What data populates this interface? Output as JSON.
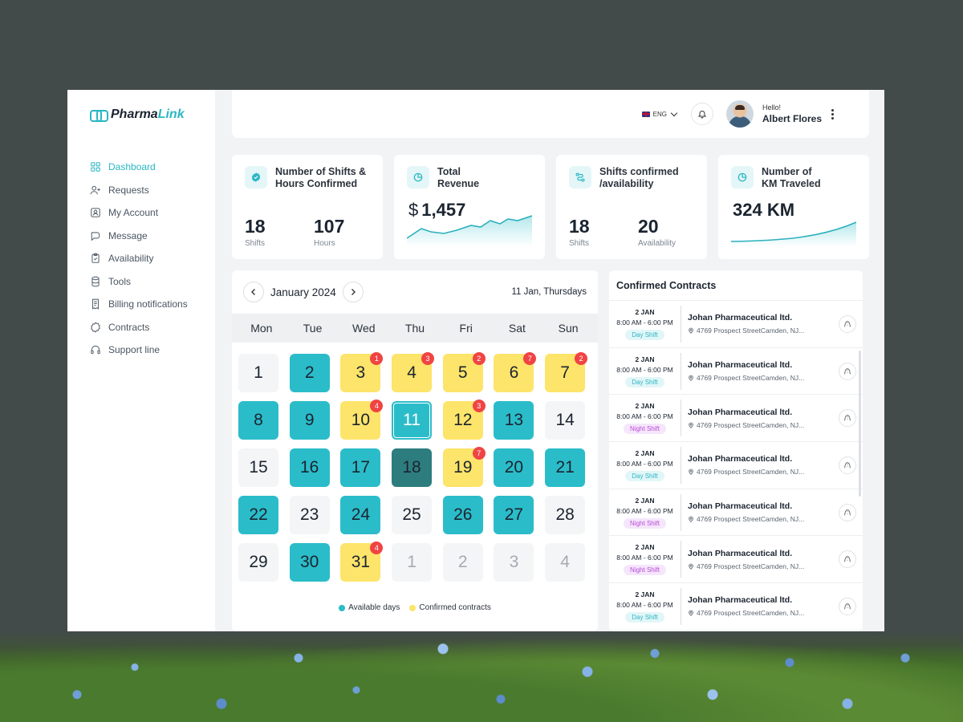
{
  "brand": {
    "name_primary": "Pharma",
    "name_accent": "Link",
    "accent_color": "#2ab7c4"
  },
  "sidebar": {
    "items": [
      {
        "label": "Dashboard",
        "icon": "grid-icon",
        "active": true
      },
      {
        "label": "Requests",
        "icon": "user-plus-icon"
      },
      {
        "label": "My Account",
        "icon": "account-icon"
      },
      {
        "label": "Message",
        "icon": "message-icon"
      },
      {
        "label": "Availability",
        "icon": "clipboard-icon"
      },
      {
        "label": "Tools",
        "icon": "database-icon"
      },
      {
        "label": "Billing notifications",
        "icon": "receipt-icon"
      },
      {
        "label": "Contracts",
        "icon": "badge-icon"
      },
      {
        "label": "Support line",
        "icon": "headset-icon"
      }
    ]
  },
  "header": {
    "language": "ENG",
    "greeting": "Hello!",
    "user_name": "Albert Flores"
  },
  "stats": [
    {
      "title_line1": "Number of Shifts &",
      "title_line2": "Hours Confirmed",
      "icon": "verified-icon",
      "values": [
        {
          "value": "18",
          "label": "Shifts"
        },
        {
          "value": "107",
          "label": "Hours"
        }
      ]
    },
    {
      "title_line1": "Total",
      "title_line2": "Revenue",
      "icon": "pie-chart-icon",
      "currency": "$",
      "amount": "1,457"
    },
    {
      "title_line1": "Shifts confirmed",
      "title_line2": "/availability",
      "icon": "route-icon",
      "values": [
        {
          "value": "18",
          "label": "Shifts"
        },
        {
          "value": "20",
          "label": "Availability"
        }
      ]
    },
    {
      "title_line1": "Number of",
      "title_line2": "KM Traveled",
      "icon": "pie-chart-icon",
      "amount": "324 KM"
    }
  ],
  "calendar": {
    "month_label": "January 2024",
    "current_date_label": "11 Jan, Thursdays",
    "weekdays": [
      "Mon",
      "Tue",
      "Wed",
      "Thu",
      "Fri",
      "Sat",
      "Sun"
    ],
    "days": [
      {
        "n": "1",
        "state": "plain"
      },
      {
        "n": "2",
        "state": "available"
      },
      {
        "n": "3",
        "state": "confirmed",
        "badge": "1"
      },
      {
        "n": "4",
        "state": "confirmed",
        "badge": "3"
      },
      {
        "n": "5",
        "state": "confirmed",
        "badge": "2"
      },
      {
        "n": "6",
        "state": "confirmed",
        "badge": "7"
      },
      {
        "n": "7",
        "state": "confirmed",
        "badge": "2"
      },
      {
        "n": "8",
        "state": "available"
      },
      {
        "n": "9",
        "state": "available"
      },
      {
        "n": "10",
        "state": "confirmed",
        "badge": "4"
      },
      {
        "n": "11",
        "state": "selected"
      },
      {
        "n": "12",
        "state": "confirmed",
        "badge": "3"
      },
      {
        "n": "13",
        "state": "available"
      },
      {
        "n": "14",
        "state": "plain"
      },
      {
        "n": "15",
        "state": "plain"
      },
      {
        "n": "16",
        "state": "available"
      },
      {
        "n": "17",
        "state": "available"
      },
      {
        "n": "18",
        "state": "dark"
      },
      {
        "n": "19",
        "state": "confirmed",
        "badge": "7"
      },
      {
        "n": "20",
        "state": "available"
      },
      {
        "n": "21",
        "state": "available"
      },
      {
        "n": "22",
        "state": "available"
      },
      {
        "n": "23",
        "state": "plain"
      },
      {
        "n": "24",
        "state": "available"
      },
      {
        "n": "25",
        "state": "plain"
      },
      {
        "n": "26",
        "state": "available"
      },
      {
        "n": "27",
        "state": "available"
      },
      {
        "n": "28",
        "state": "plain"
      },
      {
        "n": "29",
        "state": "plain"
      },
      {
        "n": "30",
        "state": "available"
      },
      {
        "n": "31",
        "state": "confirmed",
        "badge": "4"
      },
      {
        "n": "1",
        "state": "outside"
      },
      {
        "n": "2",
        "state": "outside"
      },
      {
        "n": "3",
        "state": "outside"
      },
      {
        "n": "4",
        "state": "outside"
      }
    ],
    "legend": [
      {
        "label": "Available days",
        "color": "#2bbcc9"
      },
      {
        "label": "Confirmed contracts",
        "color": "#fde46a"
      }
    ]
  },
  "contracts": {
    "title": "Confirmed Contracts",
    "items": [
      {
        "date": "2 JAN",
        "time": "8:00 AM - 6:00 PM",
        "shift": "Day Shift",
        "type": "day",
        "company": "Johan Pharmaceutical ltd.",
        "address": "4769 Prospect StreetCamden, NJ..."
      },
      {
        "date": "2 JAN",
        "time": "8:00 AM - 6:00 PM",
        "shift": "Day Shift",
        "type": "day",
        "company": "Johan Pharmaceutical ltd.",
        "address": "4769 Prospect StreetCamden, NJ..."
      },
      {
        "date": "2 JAN",
        "time": "8:00 AM - 6:00 PM",
        "shift": "Night Shift",
        "type": "night",
        "company": "Johan Pharmaceutical ltd.",
        "address": "4769 Prospect StreetCamden, NJ..."
      },
      {
        "date": "2 JAN",
        "time": "8:00 AM - 6:00 PM",
        "shift": "Day Shift",
        "type": "day",
        "company": "Johan Pharmaceutical ltd.",
        "address": "4769 Prospect StreetCamden, NJ..."
      },
      {
        "date": "2 JAN",
        "time": "8:00 AM - 6:00 PM",
        "shift": "Night Shift",
        "type": "night",
        "company": "Johan Pharmaceutical ltd.",
        "address": "4769 Prospect StreetCamden, NJ..."
      },
      {
        "date": "2 JAN",
        "time": "8:00 AM - 6:00 PM",
        "shift": "Night Shift",
        "type": "night",
        "company": "Johan Pharmaceutical ltd.",
        "address": "4769 Prospect StreetCamden, NJ..."
      },
      {
        "date": "2 JAN",
        "time": "8:00 AM - 6:00 PM",
        "shift": "Day Shift",
        "type": "day",
        "company": "Johan Pharmaceutical ltd.",
        "address": "4769 Prospect StreetCamden, NJ..."
      }
    ]
  }
}
